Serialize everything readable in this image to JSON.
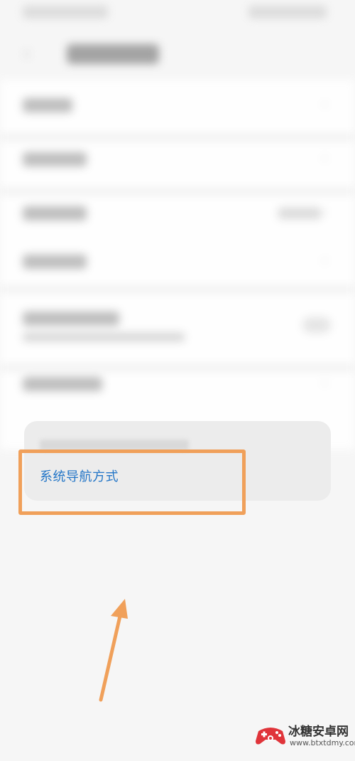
{
  "suggestion": {
    "link_label": "系统导航方式"
  },
  "watermark": {
    "site_name": "冰糖安卓网",
    "url": "www.btxtdmy.com"
  },
  "colors": {
    "link": "#2476c7",
    "highlight": "#f0a05a",
    "arrow": "#f0a05a"
  }
}
